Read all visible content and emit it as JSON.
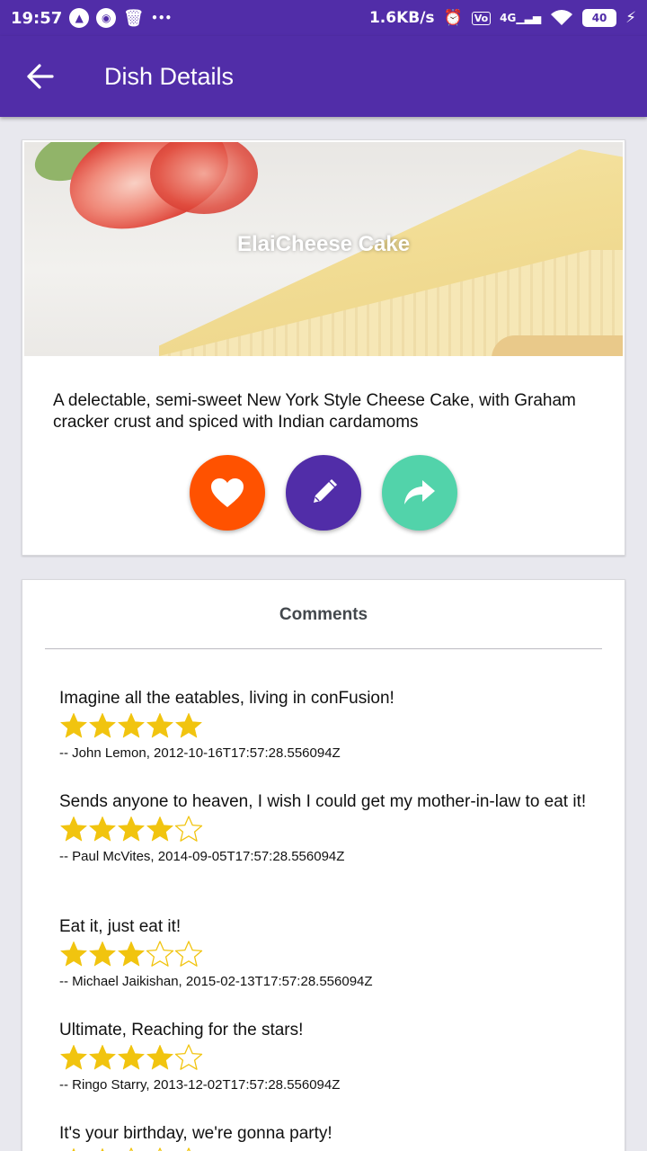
{
  "status_bar": {
    "time": "19:57",
    "net_speed": "1.6KB/s",
    "network": "4G",
    "battery": "40"
  },
  "app_bar": {
    "title": "Dish Details"
  },
  "dish": {
    "name": "ElaiCheese Cake",
    "description": "A delectable, semi-sweet New York Style Cheese Cake, with Graham cracker crust and spiced with Indian cardamoms"
  },
  "actions": {
    "favorite_color": "#ff5200",
    "edit_color": "#512da8",
    "share_color": "#52d3aa"
  },
  "comments": {
    "title": "Comments",
    "items": [
      {
        "text": "Imagine all the eatables, living in conFusion!",
        "rating": 5,
        "author": "-- John Lemon, 2012-10-16T17:57:28.556094Z"
      },
      {
        "text": "Sends anyone to heaven, I wish I could get my mother-in-law to eat it!",
        "rating": 4,
        "author": "-- Paul McVites, 2014-09-05T17:57:28.556094Z"
      },
      {
        "text": "Eat it, just eat it!",
        "rating": 3,
        "author": "-- Michael Jaikishan, 2015-02-13T17:57:28.556094Z"
      },
      {
        "text": "Ultimate, Reaching for the stars!",
        "rating": 4,
        "author": "-- Ringo Starry, 2013-12-02T17:57:28.556094Z"
      },
      {
        "text": "It's your birthday, we're gonna party!",
        "rating": 2,
        "author": ""
      }
    ]
  },
  "colors": {
    "primary": "#512da8",
    "star": "#f1c40f"
  }
}
